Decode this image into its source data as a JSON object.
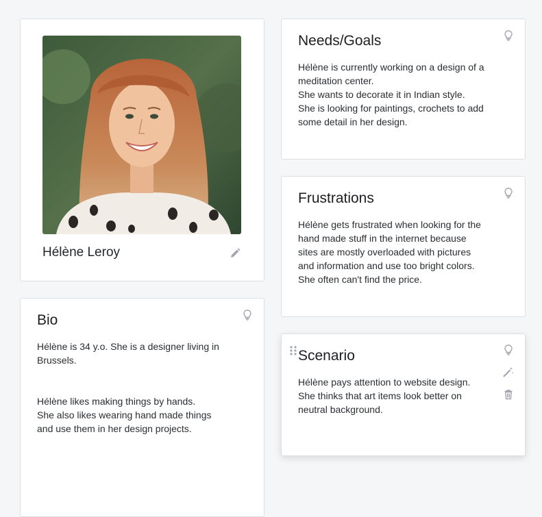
{
  "profile": {
    "name": "Hélène Leroy",
    "icons": {
      "edit": "pencil-icon"
    }
  },
  "cards": {
    "bio": {
      "title": "Bio",
      "text": "Hélène is 34 y.o. She is a designer living in\nBrussels.\n\n\nHélène likes making things by hands.\nShe also likes wearing hand made things\nand use them in her design projects."
    },
    "needs": {
      "title": "Needs/Goals",
      "text": "Hélène is currently working on a design of a\nmeditation center.\nShe wants to decorate it in Indian style.\nShe is looking for paintings, crochets to add\nsome detail in her design."
    },
    "frustrations": {
      "title": "Frustrations",
      "text": "Hélène gets frustrated when looking for the\nhand made stuff in the internet because\nsites are mostly overloaded with pictures\nand information and use too bright colors.\nShe often can't find the price."
    },
    "scenario": {
      "title": "Scenario",
      "text": "Hélène pays attention to website design.\nShe thinks that art items look better on\nneutral background."
    }
  },
  "icons": {
    "tip": "lightbulb-icon",
    "ai": "magic-wand-icon",
    "delete": "trash-icon",
    "drag": "drag-handle-icon"
  },
  "colors": {
    "background": "#f5f6f8",
    "card": "#ffffff",
    "border": "#dcdfe4",
    "icon": "#a3a7ad"
  }
}
